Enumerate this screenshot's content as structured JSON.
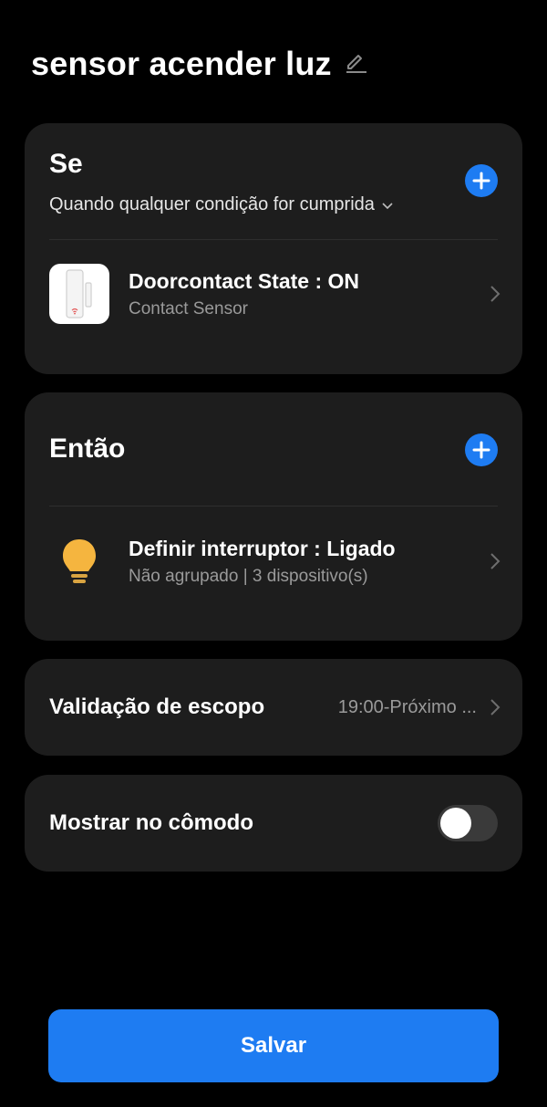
{
  "header": {
    "title": "sensor acender luz",
    "edit_icon": "pencil-icon"
  },
  "if_section": {
    "title": "Se",
    "add_icon": "plus-icon",
    "condition_mode": "Quando qualquer condição for cumprida",
    "items": [
      {
        "title": "Doorcontact State : ON",
        "subtitle": "Contact Sensor",
        "icon": "contact-sensor-icon"
      }
    ]
  },
  "then_section": {
    "title": "Então",
    "add_icon": "plus-icon",
    "items": [
      {
        "title": "Definir interruptor : Ligado",
        "subtitle": "Não agrupado | 3 dispositivo(s)",
        "icon": "lightbulb-icon"
      }
    ]
  },
  "scope": {
    "label": "Validação de escopo",
    "value": "19:00-Próximo ..."
  },
  "show_in_room": {
    "label": "Mostrar no cômodo",
    "enabled": false
  },
  "save_button": {
    "label": "Salvar"
  },
  "colors": {
    "accent": "#1e7cf2",
    "card": "#1d1d1d",
    "background": "#000000",
    "bulb": "#f5b53f"
  }
}
